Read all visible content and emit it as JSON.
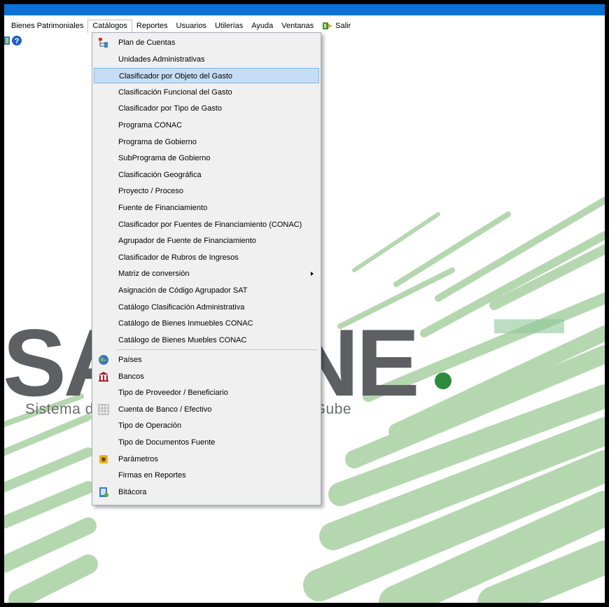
{
  "menubar": {
    "items": [
      "Bienes Patrimoniales",
      "Catálogos",
      "Reportes",
      "Usuarios",
      "Utilerías",
      "Ayuda",
      "Ventanas"
    ],
    "salir": "Salir"
  },
  "background": {
    "logo_text": "SACG.NE",
    "subtitle": "Sistema de Administración y Contabilidad Gube"
  },
  "dropdown": {
    "groupA": [
      "Plan de Cuentas",
      "Unidades Administrativas",
      "Clasificador por Objeto del Gasto",
      "Clasificación Funcional del Gasto",
      "Clasificador por Tipo de Gasto",
      "Programa CONAC",
      "Programa de Gobierno",
      "SubPrograma de Gobierno",
      "Clasificación Geográfica",
      "Proyecto / Proceso",
      "Fuente de Financiamiento",
      "Clasificador por Fuentes de Financiamiento (CONAC)",
      "Agrupador de Fuente de Financiamiento",
      "Clasificador de Rubros de Ingresos",
      "Matriz de conversión",
      "Asignación de Código Agrupador SAT",
      "Catálogo Clasificación Administrativa",
      "Catálogo de Bienes Inmuebles CONAC",
      "Catálogo de Bienes Muebles CONAC"
    ],
    "groupB": [
      "Países",
      "Bancos",
      "Tipo de Proveedor / Beneficiario",
      "Cuenta de Banco / Efectivo",
      "Tipo de Operación",
      "Tipo de Documentos Fuente",
      "Parámetros",
      "Firmas en Reportes",
      "Bitácora"
    ],
    "highlighted": "Clasificador por Objeto del Gasto",
    "submenu_item": "Matriz de conversión"
  },
  "colors": {
    "titlebar": "#0a72d6",
    "highlight": "#c6def5",
    "highlight_border": "#7fb5e6",
    "logo_gray": "#5d5f62",
    "logo_green": "#2e8b3e",
    "stroke_green": "#8fbf8a"
  },
  "icons": {
    "toolbar": [
      "app-icon",
      "help-icon"
    ],
    "salir": "exit-icon",
    "plan_de_cuentas": "tree-icon",
    "paises": "globe-icon",
    "bancos": "bank-icon",
    "cuenta_banco": "grid-icon",
    "parametros": "settings-icon",
    "bitacora": "log-icon"
  }
}
